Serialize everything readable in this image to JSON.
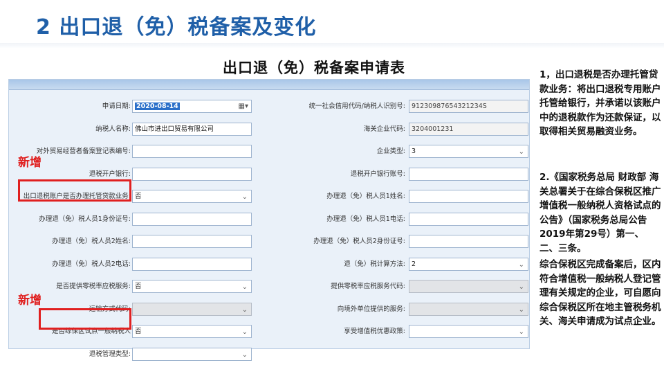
{
  "slide": {
    "title": "2 出口退（免）税备案及变化"
  },
  "form": {
    "title": "出口退（免）税备案申请表",
    "left_fields": [
      {
        "label": "申请日期:",
        "value": "2020-08-14",
        "kind": "date"
      },
      {
        "label": "纳税人名称:",
        "value": "佛山市进出口贸易有限公司",
        "kind": "text"
      },
      {
        "label": "对外贸易经营者备案登记表编号:",
        "value": "",
        "kind": "text"
      },
      {
        "label": "退税开户银行:",
        "value": "",
        "kind": "text"
      },
      {
        "label": "出口退税账户是否办理托管贷款业务:",
        "value": "否",
        "kind": "select"
      },
      {
        "label": "办理退（免）税人员1身份证号:",
        "value": "",
        "kind": "text"
      },
      {
        "label": "办理退（免）税人员2姓名:",
        "value": "",
        "kind": "text"
      },
      {
        "label": "办理退（免）税人员2电话:",
        "value": "",
        "kind": "text"
      },
      {
        "label": "是否提供零税率应税服务:",
        "value": "否",
        "kind": "select"
      },
      {
        "label": "运输方式代码:",
        "value": "",
        "kind": "select-disabled"
      },
      {
        "label": "是否综保区试点一般纳税人",
        "value": "否",
        "kind": "select"
      },
      {
        "label": "退税管理类型:",
        "value": "",
        "kind": "select"
      }
    ],
    "right_fields": [
      {
        "label": "统一社会信用代码/纳税人识别号:",
        "value": "91230987654321234S",
        "kind": "readonly"
      },
      {
        "label": "海关企业代码:",
        "value": "3204001231",
        "kind": "readonly"
      },
      {
        "label": "企业类型:",
        "value": "3",
        "kind": "select"
      },
      {
        "label": "退税开户银行账号:",
        "value": "",
        "kind": "text"
      },
      {
        "label": "办理退（免）税人员1姓名:",
        "value": "",
        "kind": "text"
      },
      {
        "label": "办理退（免）税人员1电话:",
        "value": "",
        "kind": "text"
      },
      {
        "label": "办理退（免）税人员2身份证号:",
        "value": "",
        "kind": "text"
      },
      {
        "label": "退（免）税计算方法:",
        "value": "2",
        "kind": "select"
      },
      {
        "label": "提供零税率应税服务代码:",
        "value": "",
        "kind": "select-disabled"
      },
      {
        "label": "向境外单位提供的服务:",
        "value": "",
        "kind": "select-disabled"
      },
      {
        "label": "享受增值税优惠政策:",
        "value": "",
        "kind": "select"
      }
    ]
  },
  "annotations": {
    "new_label_1": "新增",
    "new_label_2": "新增"
  },
  "notes": {
    "note1": "1，出口退税是否办理托管贷款业务：将出口退税专用账户托管给银行，并承诺以该账户中的退税款作为还款保证，以取得相关贸易融资业务。",
    "note2": "2.《国家税务总局 财政部 海关总署关于在综合保税区推广增值税一般纳税人资格试点的公告》（国家税务总局公告2019年第29号）第一、二、三条。",
    "note3": "综合保税区完成备案后，区内符合增值税一般纳税人登记管理有关规定的企业，可自愿向综合保税区所在地主管税务机关、海关申请成为试点企业。"
  },
  "colors": {
    "title_blue": "#1f5fa8",
    "highlight_red": "#e02020",
    "panel_bg": "#eaf1f9"
  }
}
